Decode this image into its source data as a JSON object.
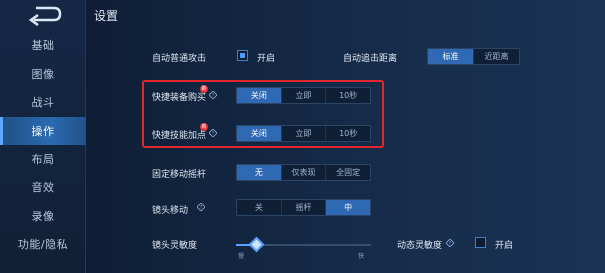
{
  "page_title": "设置",
  "sidebar": {
    "items": [
      {
        "label": "基础",
        "active": false
      },
      {
        "label": "图像",
        "active": false
      },
      {
        "label": "战斗",
        "active": false
      },
      {
        "label": "操作",
        "active": true
      },
      {
        "label": "布局",
        "active": false
      },
      {
        "label": "音效",
        "active": false
      },
      {
        "label": "录像",
        "active": false
      },
      {
        "label": "功能/隐私",
        "active": false
      }
    ]
  },
  "settings": {
    "auto_attack": {
      "label": "自动普通攻击",
      "checkbox_label": "开启",
      "checked": true
    },
    "auto_chase": {
      "label": "自动追击距离",
      "options": [
        "标准",
        "近距离"
      ],
      "selected": "标准"
    },
    "quick_buy": {
      "label": "快捷装备购买",
      "badge": "新",
      "options": [
        "关闭",
        "立即",
        "10秒"
      ],
      "selected": "关闭"
    },
    "quick_skill": {
      "label": "快捷技能加点",
      "badge": "新",
      "options": [
        "关闭",
        "立即",
        "10秒"
      ],
      "selected": "关闭"
    },
    "fixed_joystick": {
      "label": "固定移动摇杆",
      "options": [
        "无",
        "仅表现",
        "全固定"
      ],
      "selected": "无"
    },
    "camera_move": {
      "label": "镜头移动",
      "options": [
        "关",
        "摇杆",
        "中"
      ],
      "selected": "中"
    },
    "camera_sensitivity": {
      "label": "镜头灵敏度",
      "min_label": "慢",
      "max_label": "快",
      "value": 0.15
    },
    "dynamic_sensitivity": {
      "label": "动态灵敏度",
      "checkbox_label": "开启",
      "checked": false
    }
  },
  "colors": {
    "accent": "#2f69b4",
    "highlight_box": "#e2262c"
  }
}
